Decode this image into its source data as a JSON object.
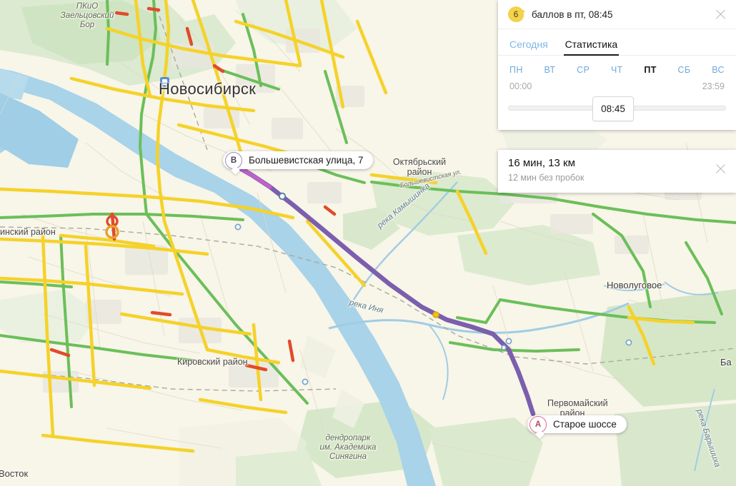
{
  "stats_panel": {
    "score": "6",
    "title": "баллов в пт, 08:45",
    "close_label": "×",
    "tabs": [
      {
        "label": "Сегодня",
        "active": false
      },
      {
        "label": "Статистика",
        "active": true
      }
    ],
    "days": [
      {
        "label": "ПН",
        "active": false
      },
      {
        "label": "ВТ",
        "active": false
      },
      {
        "label": "СР",
        "active": false
      },
      {
        "label": "ЧТ",
        "active": false
      },
      {
        "label": "ПТ",
        "active": true
      },
      {
        "label": "СБ",
        "active": false
      },
      {
        "label": "ВС",
        "active": false
      }
    ],
    "time_start": "00:00",
    "time_end": "23:59",
    "slider_value": "08:45"
  },
  "route_panel": {
    "summary": "16 мин, 13 км",
    "subtitle": "12 мин без пробок",
    "close_label": "×"
  },
  "markers": {
    "b": {
      "letter": "В",
      "label": "Большевистская улица, 7"
    },
    "a": {
      "letter": "A",
      "label": "Старое шоссе"
    }
  },
  "map_labels": {
    "city": "Новосибирск",
    "park_zaeltsovsky": "ПКиО\nЗаельцовский\nБор",
    "park_zaeltsovsky_l1": "ПКиО",
    "park_zaeltsovsky_l2": "Заельцовский",
    "park_zaeltsovsky_l3": "Бор",
    "district_oktyabrsky_l1": "Октябрьский",
    "district_oktyabrsky_l2": "район",
    "district_leninsky": "инский район",
    "district_kirovsky": "Кировский район",
    "district_pervomaysky_l1": "Первомайский",
    "district_pervomaysky_l2": "район",
    "town_novolugovoe": "Новолуговое",
    "town_vostok": "Восток",
    "town_ba": "Ба",
    "river_kamyshinka": "река Камышинка",
    "river_inya": "река Иня",
    "river_baryshikha": "река Барышиха",
    "dendropark_l1": "дендропарк",
    "dendropark_l2": "им. Академика",
    "dendropark_l3": "Синягина",
    "street_bolshevistskaya": "Большевистская ул."
  },
  "colors": {
    "land": "#f8f5e9",
    "water": "#a8d3e8",
    "park": "#d5e8cc",
    "traffic_free": "#6bbf59",
    "traffic_slow": "#f5d22a",
    "traffic_jam": "#e04b2a",
    "route": "#7b5fad",
    "accent_link": "#6fa8dc",
    "badge": "#f4d24a"
  }
}
